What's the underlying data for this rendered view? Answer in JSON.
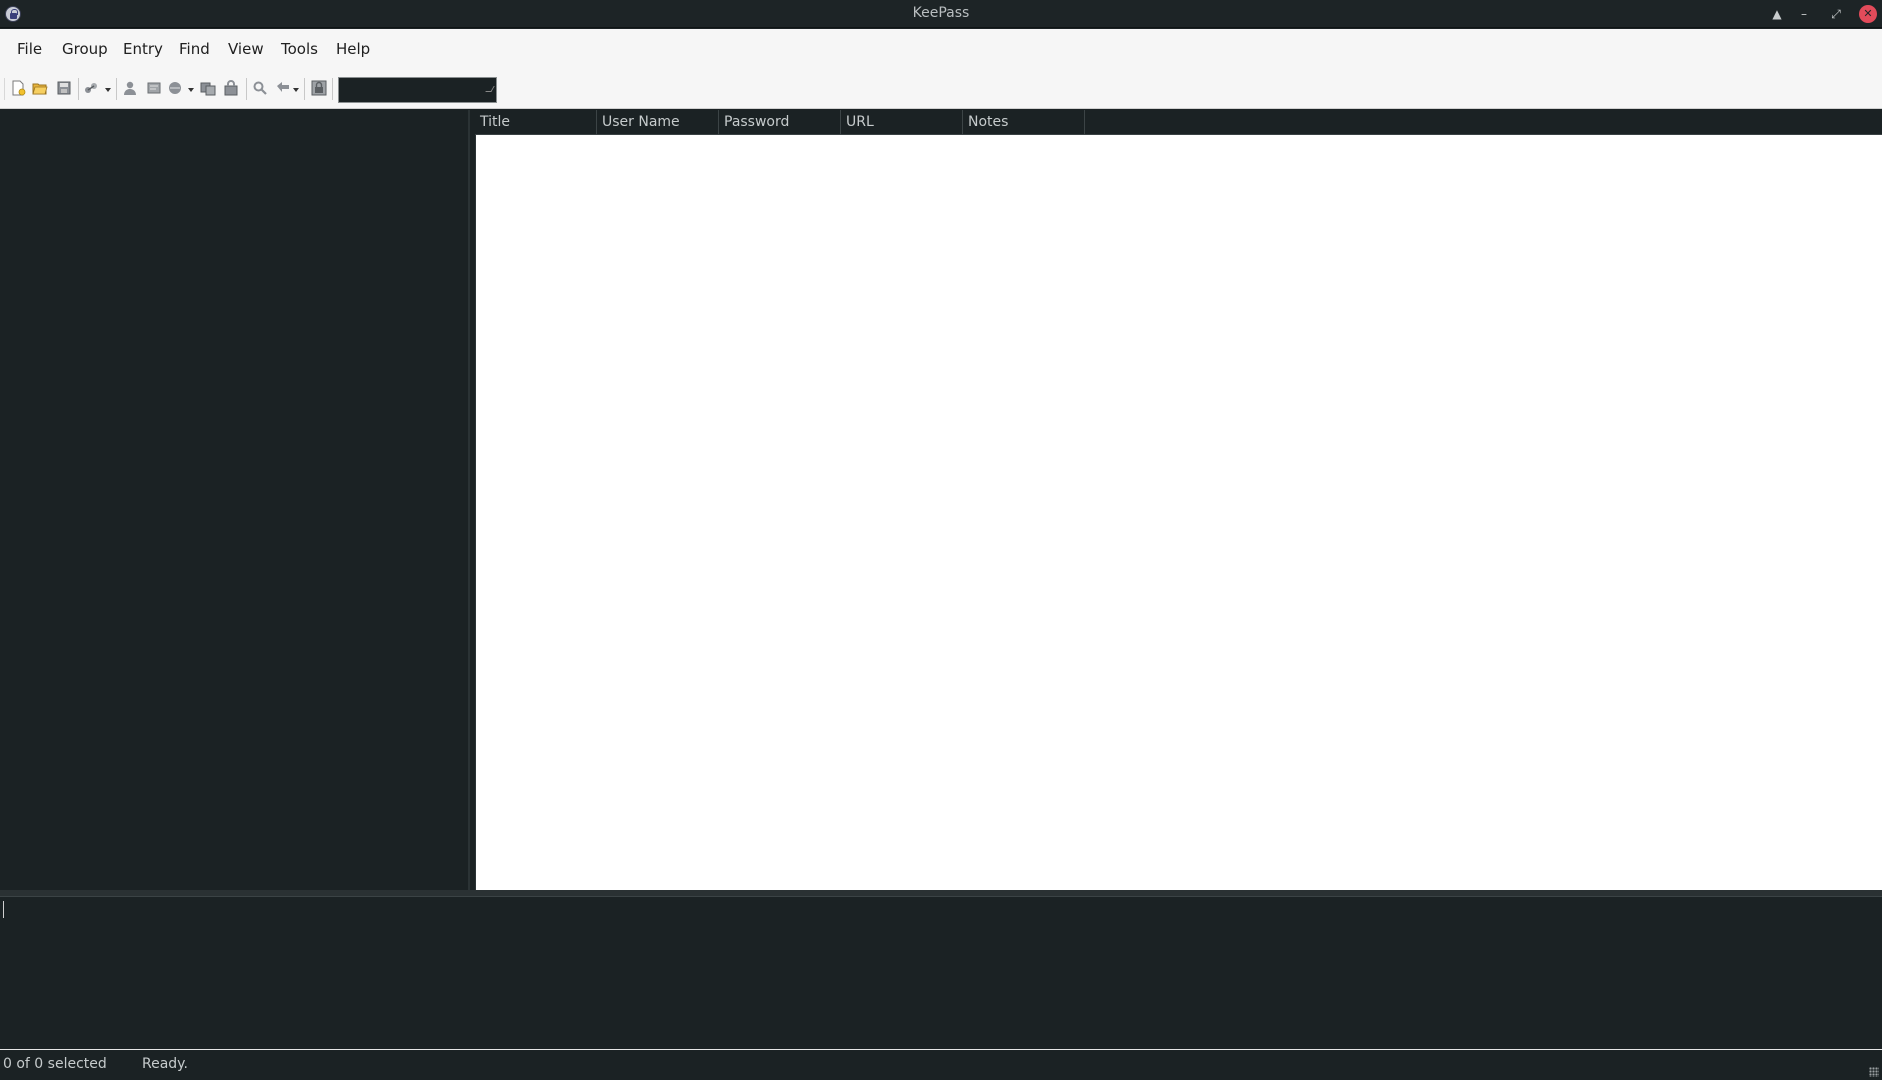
{
  "window": {
    "title": "KeePass"
  },
  "menu": {
    "items": [
      "File",
      "Group",
      "Entry",
      "Find",
      "View",
      "Tools",
      "Help"
    ]
  },
  "toolbar": {
    "icons": [
      "new-database-icon",
      "open-database-icon",
      "save-database-icon",
      "sync-icon",
      "add-entry-icon",
      "edit-entry-icon",
      "delete-entry-icon",
      "copy-username-icon",
      "copy-password-icon",
      "find-icon",
      "auto-type-icon",
      "lock-workspace-icon"
    ],
    "search_value": ""
  },
  "entries": {
    "columns": [
      "Title",
      "User Name",
      "Password",
      "URL",
      "Notes"
    ],
    "rows": []
  },
  "status": {
    "selection": "0 of 0 selected",
    "message": "Ready."
  },
  "colors": {
    "dark_bg": "#1b2224",
    "light_bg": "#f6f6f6",
    "close_button": "#e24b5a"
  }
}
